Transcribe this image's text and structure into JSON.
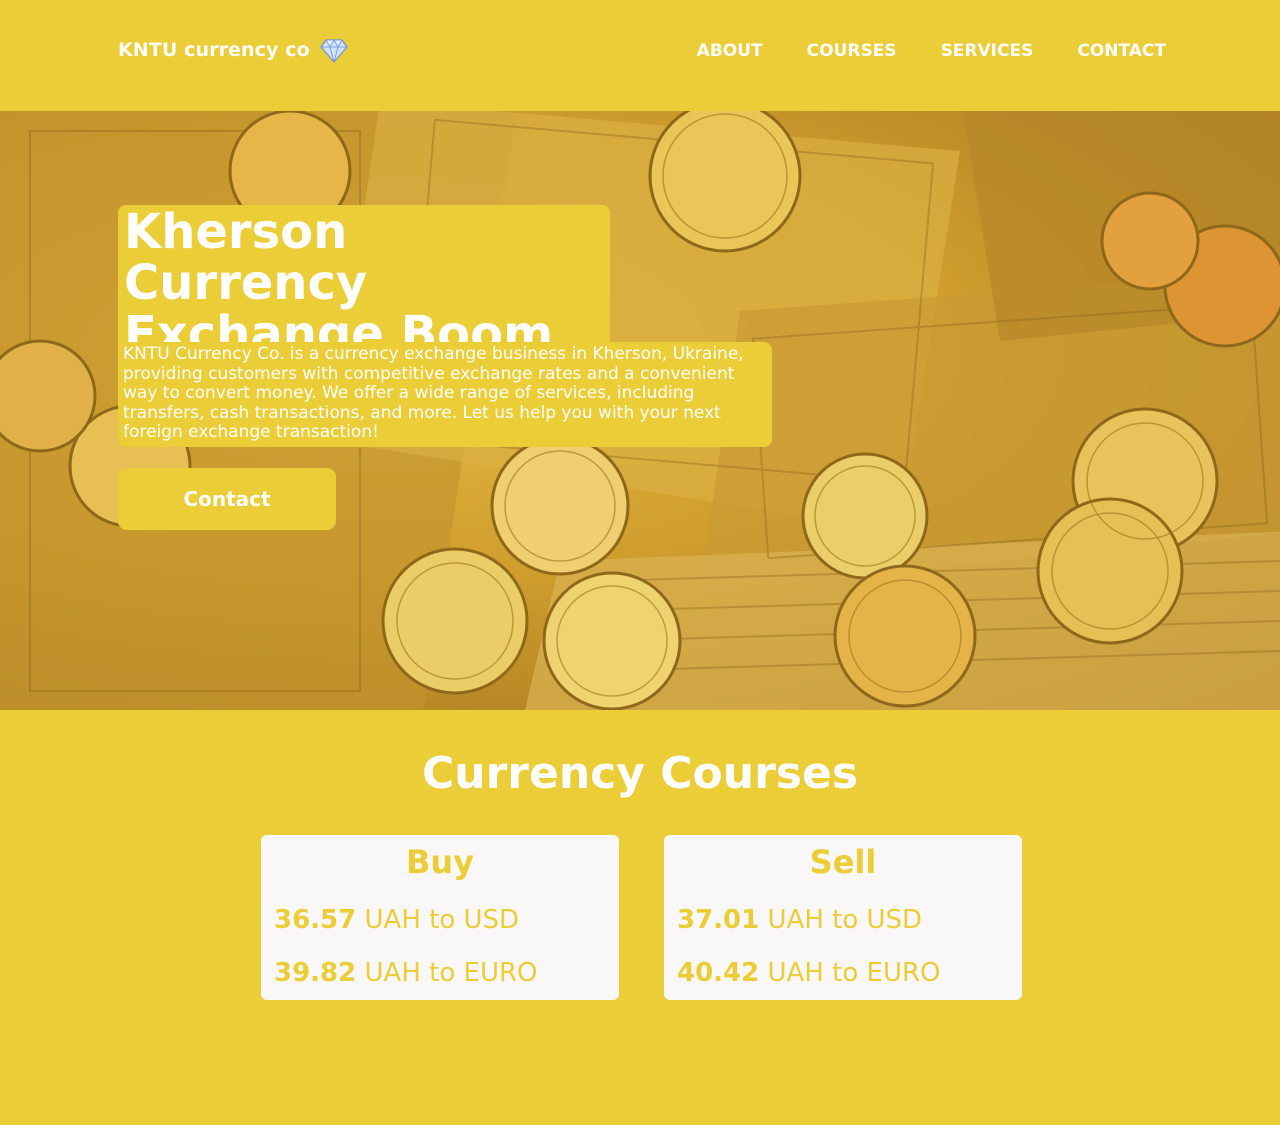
{
  "header": {
    "brand": "KNTU currency co",
    "brand_icon": "diamond-icon",
    "nav": [
      "ABOUT",
      "COURSES",
      "SERVICES",
      "CONTACT"
    ]
  },
  "hero": {
    "background": "gold-coins-and-dollar-bills-photo",
    "title": "Kherson Currency Exchange Boom",
    "description": "KNTU Currency Co. is a currency exchange business in Kherson, Ukraine, providing customers with competitive exchange rates and a convenient way to convert money. We offer a wide range of services, including transfers, cash transactions, and more. Let us help you with your next foreign exchange transaction!",
    "button": "Contact"
  },
  "courses": {
    "title": "Currency Courses",
    "buy": {
      "title": "Buy",
      "rates": [
        {
          "value": "36.57",
          "label": "UAH to USD"
        },
        {
          "value": "39.82",
          "label": "UAH to EURO"
        }
      ]
    },
    "sell": {
      "title": "Sell",
      "rates": [
        {
          "value": "37.01",
          "label": "UAH to USD"
        },
        {
          "value": "40.42",
          "label": "UAH to EURO"
        }
      ]
    }
  },
  "colors": {
    "accent": "#ebcd37",
    "card_bg": "#f9f7f7",
    "text": "#ffffff"
  }
}
